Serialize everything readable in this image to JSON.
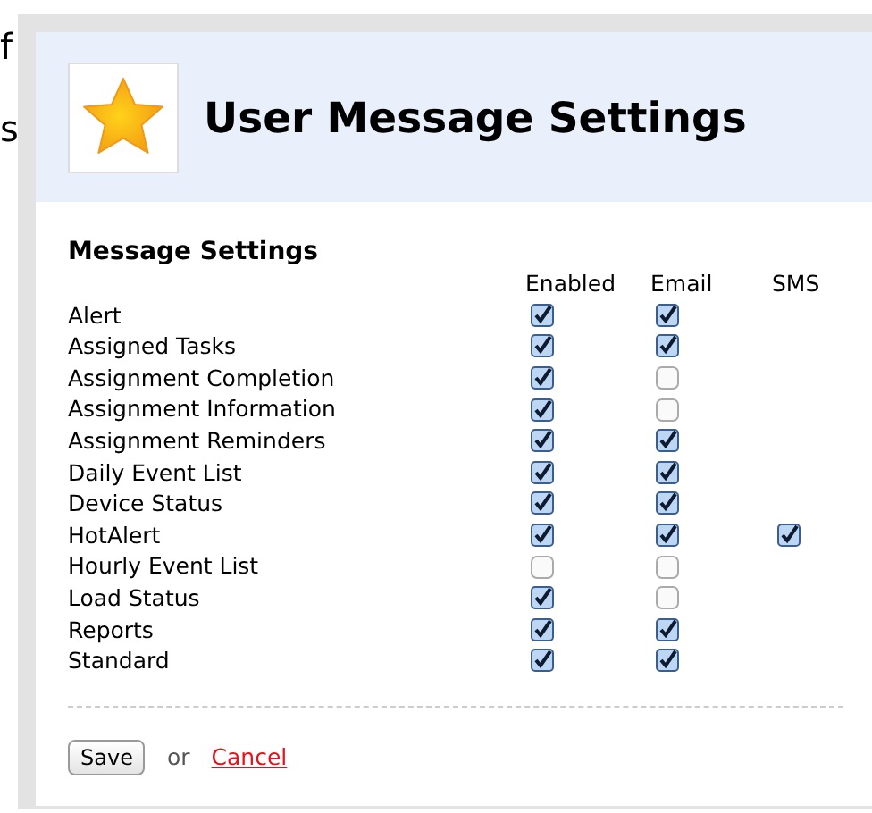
{
  "background_text": [
    "f",
    "s"
  ],
  "header": {
    "title": "User Message Settings"
  },
  "section_title": "Message Settings",
  "columns": [
    "Enabled",
    "Email",
    "SMS"
  ],
  "rows": [
    {
      "name": "Alert",
      "enabled": true,
      "email": true
    },
    {
      "name": "Assigned Tasks",
      "enabled": true,
      "email": true
    },
    {
      "name": "Assignment Completion",
      "enabled": true,
      "email": false
    },
    {
      "name": "Assignment Information",
      "enabled": true,
      "email": false
    },
    {
      "name": "Assignment Reminders",
      "enabled": true,
      "email": true
    },
    {
      "name": "Daily Event List",
      "enabled": true,
      "email": true
    },
    {
      "name": "Device Status",
      "enabled": true,
      "email": true
    },
    {
      "name": "HotAlert",
      "enabled": true,
      "email": true,
      "sms": true
    },
    {
      "name": "Hourly Event List",
      "enabled": false,
      "email": false
    },
    {
      "name": "Load Status",
      "enabled": true,
      "email": false
    },
    {
      "name": "Reports",
      "enabled": true,
      "email": true
    },
    {
      "name": "Standard",
      "enabled": true,
      "email": true
    }
  ],
  "footer": {
    "save": "Save",
    "or": "or",
    "cancel": "Cancel"
  }
}
